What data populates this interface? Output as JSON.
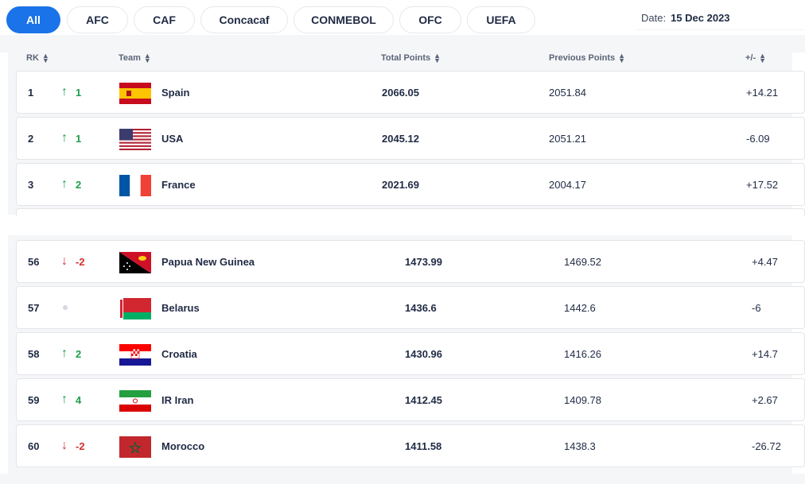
{
  "filters": [
    "All",
    "AFC",
    "CAF",
    "Concacaf",
    "CONMEBOL",
    "OFC",
    "UEFA"
  ],
  "active_filter": "All",
  "date": {
    "label": "Date:",
    "value": "15 Dec 2023"
  },
  "headers": {
    "rank": "RK",
    "team": "Team",
    "total": "Total Points",
    "previous": "Previous Points",
    "diff": "+/-"
  },
  "rows": [
    {
      "rank": "1",
      "move_dir": "up",
      "move": "1",
      "team": "Spain",
      "flag": "spain-flag",
      "total": "2066.05",
      "previous": "2051.84",
      "diff": "+14.21"
    },
    {
      "rank": "2",
      "move_dir": "up",
      "move": "1",
      "team": "USA",
      "flag": "usa-flag",
      "total": "2045.12",
      "previous": "2051.21",
      "diff": "-6.09"
    },
    {
      "rank": "3",
      "move_dir": "up",
      "move": "2",
      "team": "France",
      "flag": "france-flag",
      "total": "2021.69",
      "previous": "2004.17",
      "diff": "+17.52"
    },
    {
      "rank": "56",
      "move_dir": "down",
      "move": "-2",
      "team": "Papua New Guinea",
      "flag": "papua-new-guinea-flag",
      "total": "1473.99",
      "previous": "1469.52",
      "diff": "+4.47"
    },
    {
      "rank": "57",
      "move_dir": "none",
      "move": "",
      "team": "Belarus",
      "flag": "belarus-flag",
      "total": "1436.6",
      "previous": "1442.6",
      "diff": "-6"
    },
    {
      "rank": "58",
      "move_dir": "up",
      "move": "2",
      "team": "Croatia",
      "flag": "croatia-flag",
      "total": "1430.96",
      "previous": "1416.26",
      "diff": "+14.7"
    },
    {
      "rank": "59",
      "move_dir": "up",
      "move": "4",
      "team": "IR Iran",
      "flag": "iran-flag",
      "total": "1412.45",
      "previous": "1409.78",
      "diff": "+2.67"
    },
    {
      "rank": "60",
      "move_dir": "down",
      "move": "-2",
      "team": "Morocco",
      "flag": "morocco-flag",
      "total": "1411.58",
      "previous": "1438.3",
      "diff": "-26.72"
    }
  ],
  "colors": {
    "accent": "#1a73e8",
    "up": "#1e9e4a",
    "down": "#d3302f"
  }
}
